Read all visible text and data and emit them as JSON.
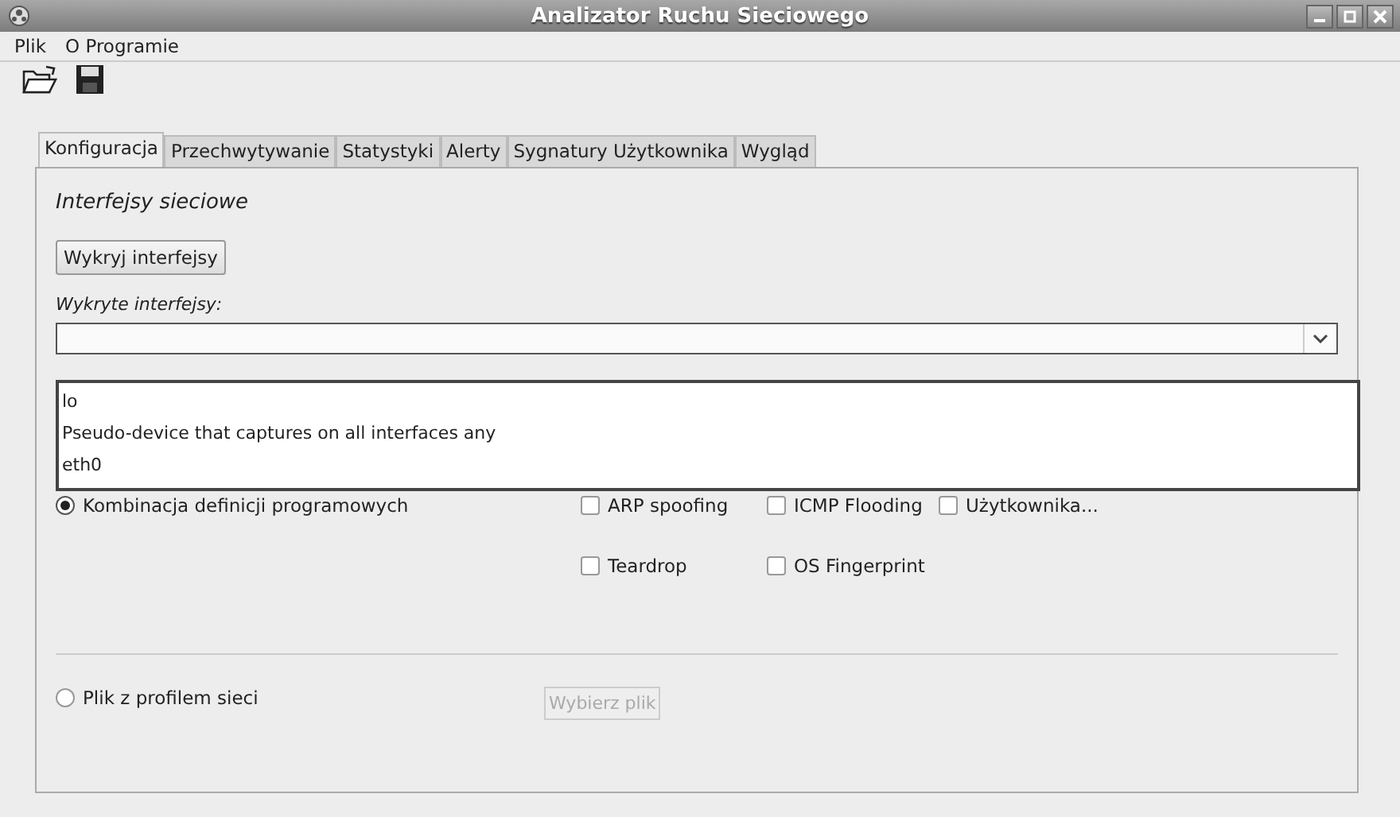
{
  "window": {
    "title": "Analizator Ruchu Sieciowego"
  },
  "menu": [
    "Plik",
    "O Programie"
  ],
  "tabs": [
    {
      "label": "Konfiguracja",
      "selected": true
    },
    {
      "label": "Przechwytywanie",
      "selected": false
    },
    {
      "label": "Statystyki",
      "selected": false
    },
    {
      "label": "Alerty",
      "selected": false
    },
    {
      "label": "Sygnatury Użytkownika",
      "selected": false
    },
    {
      "label": "Wygląd",
      "selected": false
    }
  ],
  "section_title": "Interfejsy sieciowe",
  "detect_button": "Wykryj interfejsy",
  "detected_label": "Wykryte interfejsy:",
  "interfaces_dropdown": {
    "expanded": true,
    "items": [
      "lo",
      "Pseudo-device that captures on all interfaces any",
      "eth0"
    ]
  },
  "mode_radios": [
    {
      "label": "Kombinacja definicji programowych",
      "selected": true
    },
    {
      "label": "Plik z profilem sieci",
      "selected": false
    }
  ],
  "attack_checkboxes": [
    {
      "label": "ARP spoofing",
      "checked": false
    },
    {
      "label": "ICMP Flooding",
      "checked": false
    },
    {
      "label": "Użytkownika...",
      "checked": false
    },
    {
      "label": "Teardrop",
      "checked": false
    },
    {
      "label": "OS Fingerprint",
      "checked": false
    }
  ],
  "file_button": {
    "label": "Wybierz plik",
    "disabled": true
  }
}
